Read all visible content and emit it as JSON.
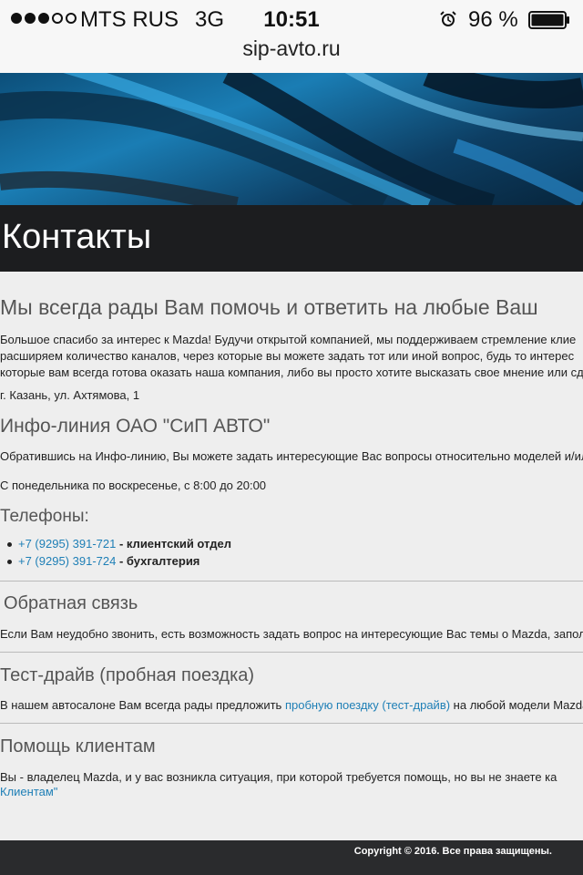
{
  "status_bar": {
    "carrier": "MTS RUS",
    "network": "3G",
    "time": "10:51",
    "battery_percent": "96 %",
    "signal_filled": 3,
    "signal_total": 5
  },
  "browser": {
    "url": "sip-avto.ru"
  },
  "page": {
    "title": "Контакты",
    "headline": "Мы всегда рады Вам помочь и ответить на любые Ваш",
    "intro_lines": [
      "Большое спасибо за интерес к Mazda! Будучи открытой компанией, мы поддерживаем стремление клие",
      "расширяем количество каналов, через которые вы можете задать тот или иной вопрос, будь то интерес",
      "которые вам всегда готова оказать наша компания, либо вы просто хотите высказать свое мнение или сдел"
    ],
    "address": "г. Казань, ул. Ахтямова, 1",
    "infoline": {
      "heading": "Инфо-линия ОАО \"СиП АВТО\"",
      "text": "Обратившись на Инфо-линию, Вы можете задать интересующие Вас вопросы относительно моделей и/или",
      "hours": "С понедельника по воскресенье, с 8:00 до 20:00"
    },
    "phones": {
      "heading": "Телефоны:",
      "items": [
        {
          "number": "+7 (9295) 391-721",
          "label": " - клиентский отдел"
        },
        {
          "number": "+7 (9295) 391-724",
          "label": " - бухгалтерия"
        }
      ]
    },
    "feedback": {
      "heading": "Обратная связь",
      "text": "Если Вам неудобно звонить, есть возможность задать вопрос на интересующие Вас темы о Mazda, заполни"
    },
    "test_drive": {
      "heading": "Тест-драйв (пробная поездка)",
      "text_before": "В нашем автосалоне Вам всегда рады предложить ",
      "link": "пробную поездку (тест-драйв)",
      "text_after": " на любой модели Mazda."
    },
    "help": {
      "heading": "Помощь клиентам",
      "text": "Вы - владелец Mazda, и у вас возникла ситуация, при которой требуется помощь, но вы не знаете ка",
      "link": "Клиентам\""
    }
  },
  "footer": {
    "copyright": "Copyright © 2016. Все права защищены."
  },
  "colors": {
    "link": "#1e7fb6",
    "title_bar": "#1c1d1f",
    "footer": "#2a2b2d",
    "background": "#eeeeee"
  }
}
